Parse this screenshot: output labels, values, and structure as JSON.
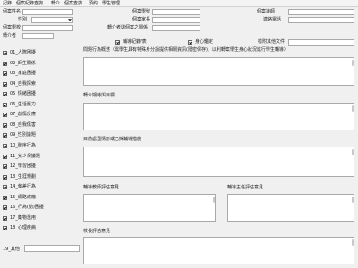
{
  "menu": {
    "items": [
      "記錄",
      "個案紀錄查詢",
      "轉介",
      "個案查詢",
      "預約",
      "學生管理"
    ]
  },
  "header": {
    "case_name_label": "個案姓名",
    "gender_label": "性別",
    "school_label": "個案學校",
    "referrer_label": "轉介者",
    "student_no_label": "個案學號",
    "parent_label": "個案家長",
    "relation_label": "轉介者與個案之關係",
    "class_label": "個案導師",
    "phone_label": "連絡電話",
    "class_value": ""
  },
  "flags": {
    "guidance_record_label": "輔導紀錄/表",
    "identified_label": "身心鑑定",
    "other_doc_label": "檢附其他文件"
  },
  "categories": [
    {
      "label": "01_人際困擾",
      "checked": true
    },
    {
      "label": "02_師生關係",
      "checked": true
    },
    {
      "label": "03_家庭困擾",
      "checked": true
    },
    {
      "label": "04_自我探索",
      "checked": true
    },
    {
      "label": "05_情緒困擾",
      "checked": true
    },
    {
      "label": "06_生活壓力",
      "checked": true
    },
    {
      "label": "07_創傷反應",
      "checked": true
    },
    {
      "label": "08_自我傷害",
      "checked": true
    },
    {
      "label": "09_性別議題",
      "checked": true
    },
    {
      "label": "10_脫序行為",
      "checked": true
    },
    {
      "label": "11_兒少保議題",
      "checked": true
    },
    {
      "label": "12_學習困擾",
      "checked": true
    },
    {
      "label": "13_生涯規劃",
      "checked": true
    },
    {
      "label": "14_偏差行為",
      "checked": true
    },
    {
      "label": "15_網路成癮",
      "checked": true
    },
    {
      "label": "16_行為(動)困擾",
      "checked": true
    },
    {
      "label": "17_藥物濫用",
      "checked": true
    },
    {
      "label": "18_心理疾病",
      "checked": true
    }
  ],
  "other_category": {
    "label": "19_其他",
    "value": ""
  },
  "sections": {
    "problem_desc": "問題行為概述（需學生具有特殊身分請提供相關資訊(隱密保存)，以利轉案學生身心狀況進行學生輔導）",
    "expectation": "轉介期待與目標",
    "past_measures": "目前處遇情形或已採輔導措施",
    "teacher_opinion": "輔導教師評估意見",
    "director_opinion": "輔導主任評估意見",
    "principal_opinion": "校長評估意見"
  }
}
